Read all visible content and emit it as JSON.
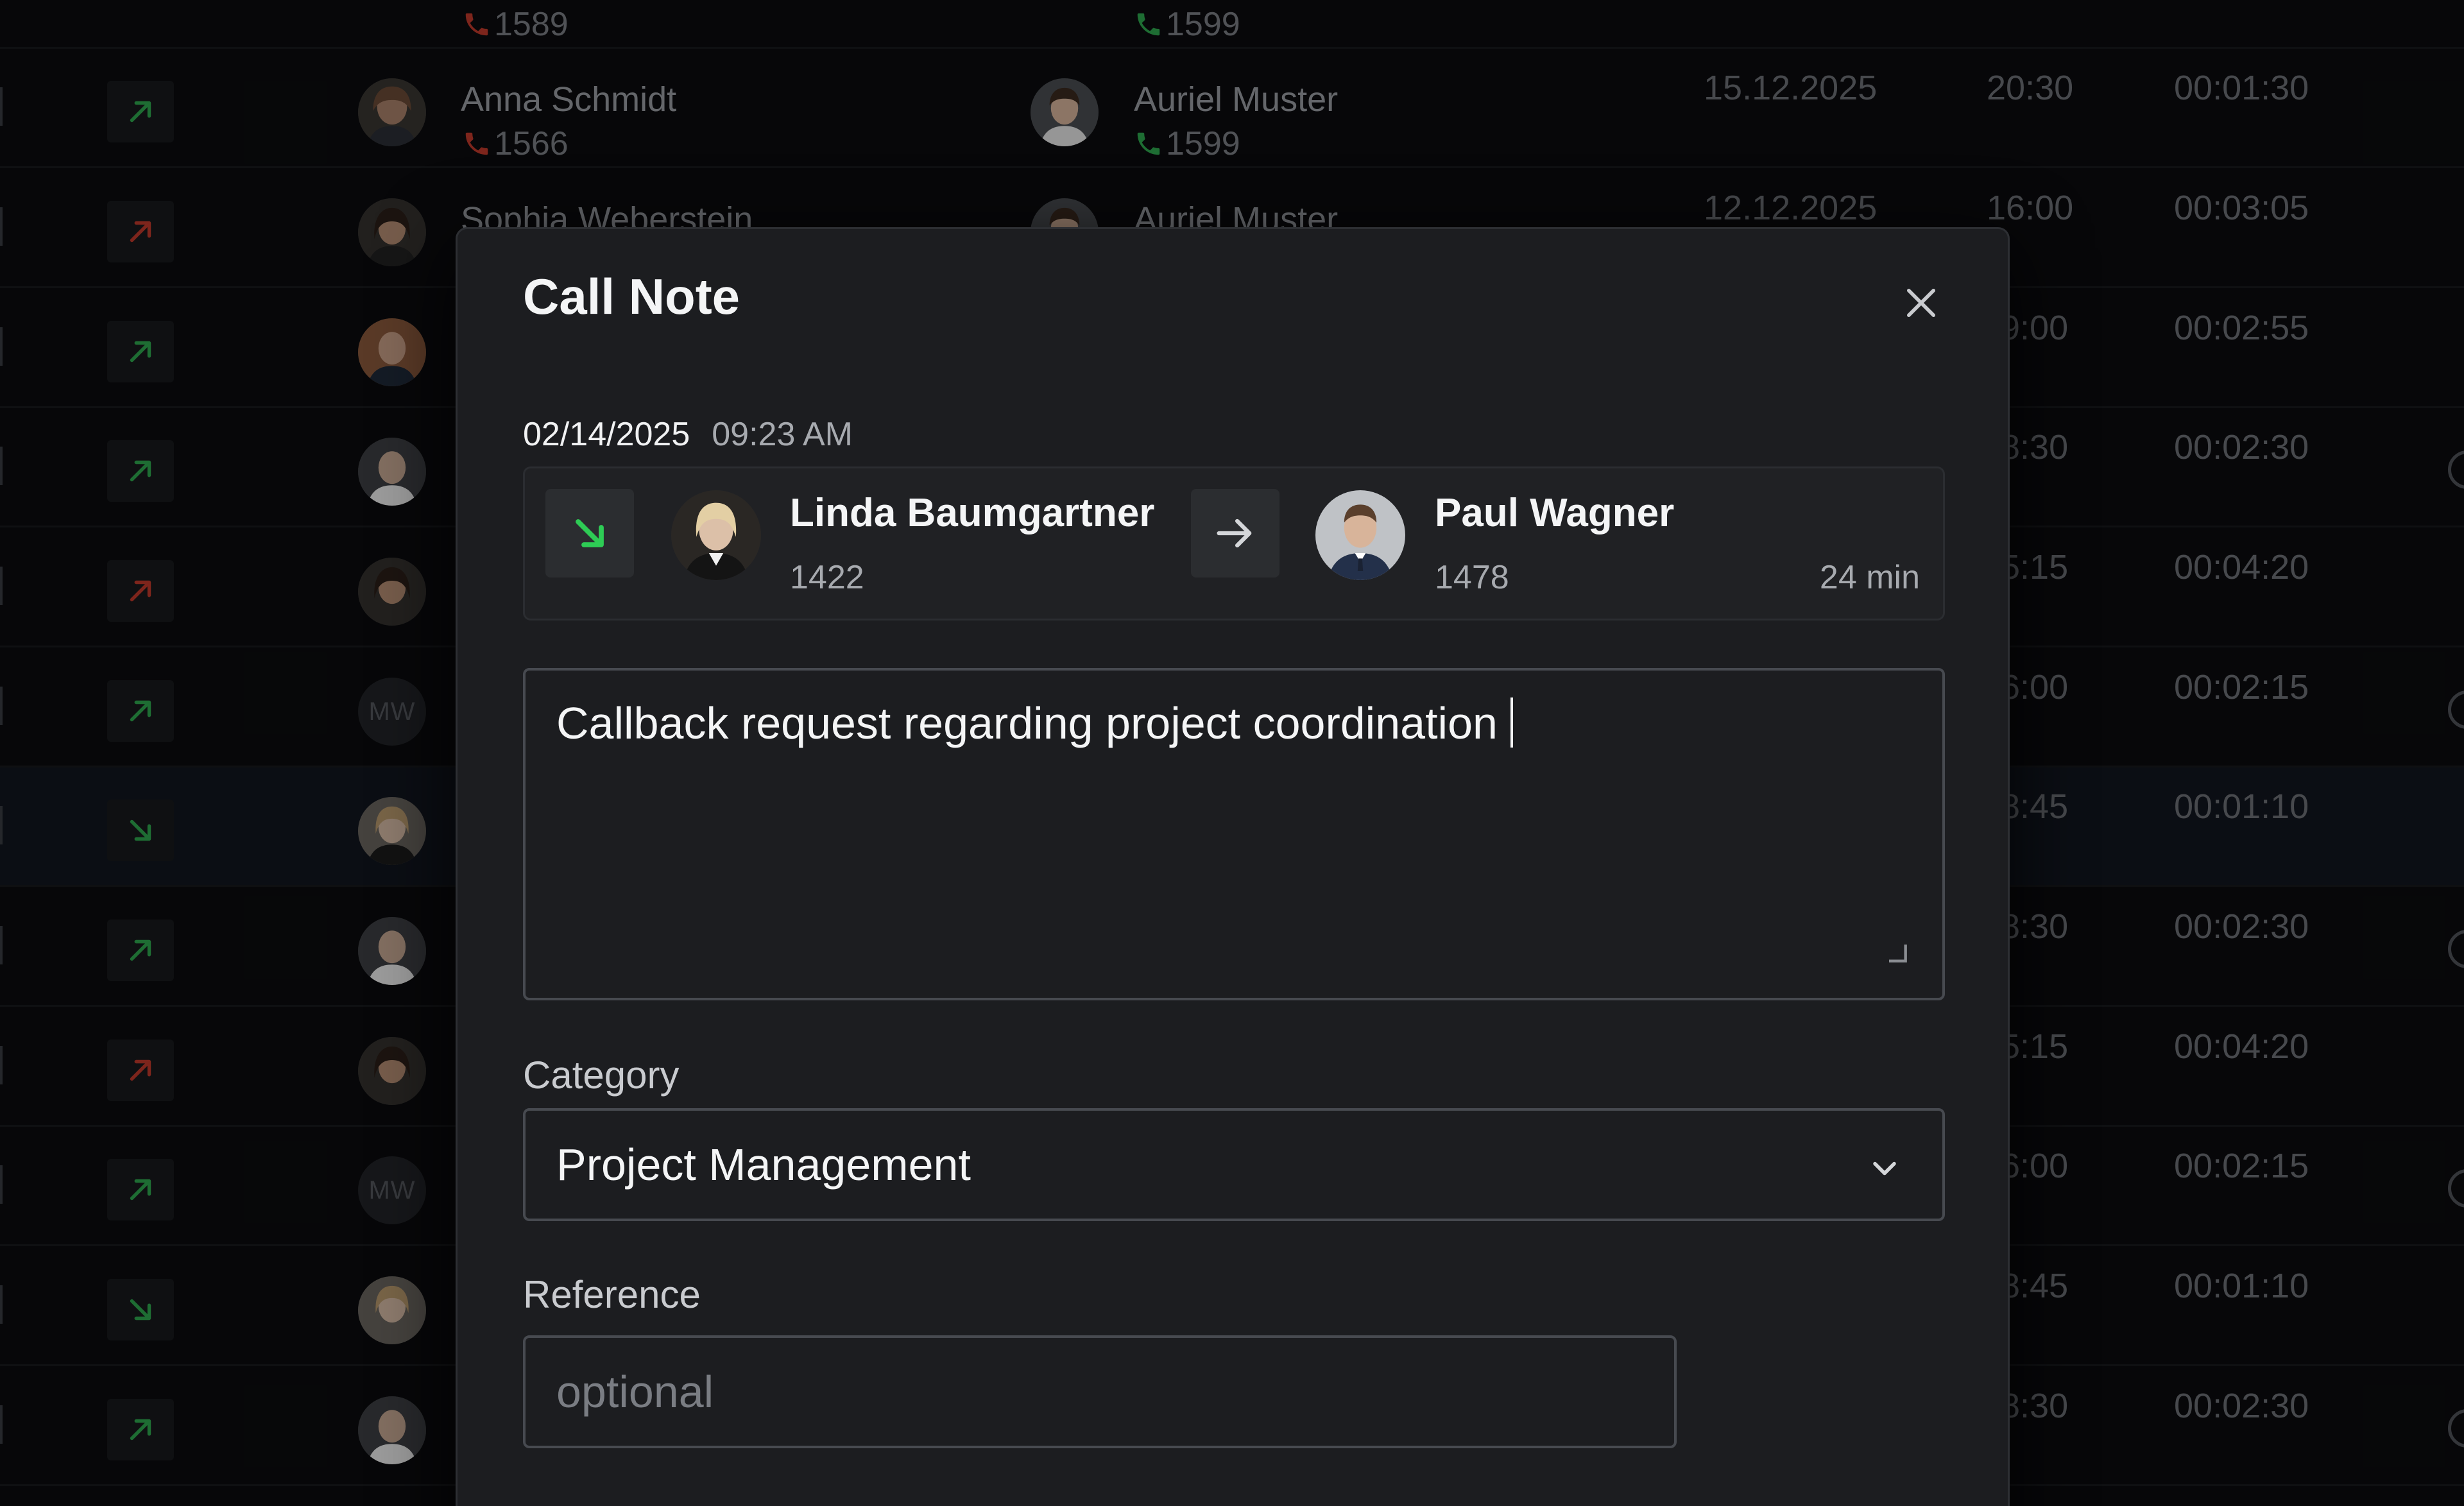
{
  "call_list": {
    "partial_top": {
      "ext1": "1589",
      "ext2": "1599"
    },
    "rows": [
      {
        "direction": "outgoing",
        "arrow_color": "#2fa84f",
        "from_name": "Anna Schmidt",
        "from_ext": "1566",
        "from_ext_color": "#c0392b",
        "to_name": "Auriel Muster",
        "to_ext": "1599",
        "to_ext_color": "#2fa84f",
        "date": "15.12.2025",
        "time": "20:30",
        "duration": "00:01:30"
      },
      {
        "direction": "outgoing",
        "arrow_color": "#c0392b",
        "from_name": "Sophia Weberstein",
        "to_name": "Auriel Muster",
        "date": "12.12.2025",
        "time": "16:00",
        "duration": "00:03:05"
      },
      {
        "direction": "outgoing",
        "arrow_color": "#2fa84f",
        "time_partial": "9:00",
        "duration": "00:02:55"
      },
      {
        "direction": "outgoing",
        "arrow_color": "#2fa84f",
        "time_partial": "8:30",
        "duration": "00:02:30"
      },
      {
        "direction": "outgoing",
        "arrow_color": "#c0392b",
        "time_partial": "5:15",
        "duration": "00:04:20"
      },
      {
        "direction": "outgoing",
        "arrow_color": "#2fa84f",
        "avatar_initials": "MW",
        "time_partial": "6:00",
        "duration": "00:02:15"
      },
      {
        "direction": "incoming",
        "arrow_color": "#2fa84f",
        "selected": true,
        "time_partial": "8:45",
        "duration": "00:01:10"
      },
      {
        "direction": "outgoing",
        "arrow_color": "#2fa84f",
        "time_partial": "8:30",
        "duration": "00:02:30"
      },
      {
        "direction": "outgoing",
        "arrow_color": "#c0392b",
        "time_partial": "5:15",
        "duration": "00:04:20"
      },
      {
        "direction": "outgoing",
        "arrow_color": "#2fa84f",
        "avatar_initials": "MW",
        "time_partial": "6:00",
        "duration": "00:02:15"
      },
      {
        "direction": "incoming",
        "arrow_color": "#2fa84f",
        "time_partial": "8:45",
        "duration": "00:01:10"
      },
      {
        "direction": "outgoing",
        "arrow_color": "#2fa84f",
        "time_partial": "8:30",
        "duration": "00:02:30"
      }
    ]
  },
  "modal": {
    "title": "Call Note",
    "close_icon": "close-icon",
    "date": "02/14/2025",
    "time": "09:23 AM",
    "call": {
      "direction": "incoming",
      "direction_color": "#2ecc55",
      "from_name": "Linda Baumgartner",
      "from_ext": "1422",
      "to_name": "Paul Wagner",
      "to_ext": "1478",
      "duration": "24 min"
    },
    "note_text": "Callback request regarding project coordination",
    "category_label": "Category",
    "category_value": "Project Management",
    "reference_label": "Reference",
    "reference_placeholder": "optional",
    "reference_value": ""
  },
  "colors": {
    "background": "#0b0c0e",
    "modal_bg": "#1c1d20",
    "incoming_green": "#2ecc55",
    "missed_red": "#c0392b"
  }
}
